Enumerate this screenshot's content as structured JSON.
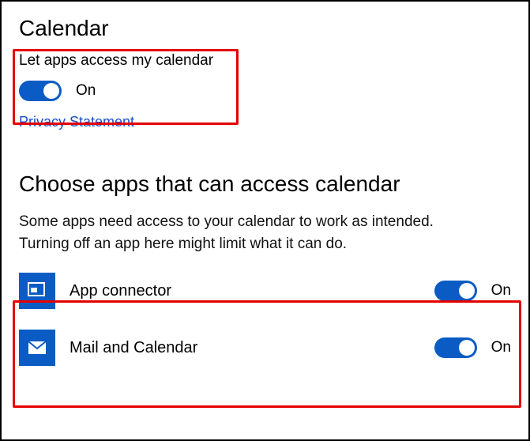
{
  "title": "Calendar",
  "master": {
    "label": "Let apps access my calendar",
    "state": "On"
  },
  "privacy_link": "Privacy Statement",
  "section2": {
    "heading": "Choose apps that can access calendar",
    "help": "Some apps need access to your calendar to work as intended. Turning off an app here might limit what it can do."
  },
  "apps": [
    {
      "name": "App connector",
      "state": "On"
    },
    {
      "name": "Mail and Calendar",
      "state": "On"
    }
  ],
  "colors": {
    "accent": "#0a5cc4",
    "highlight": "#e30000"
  }
}
